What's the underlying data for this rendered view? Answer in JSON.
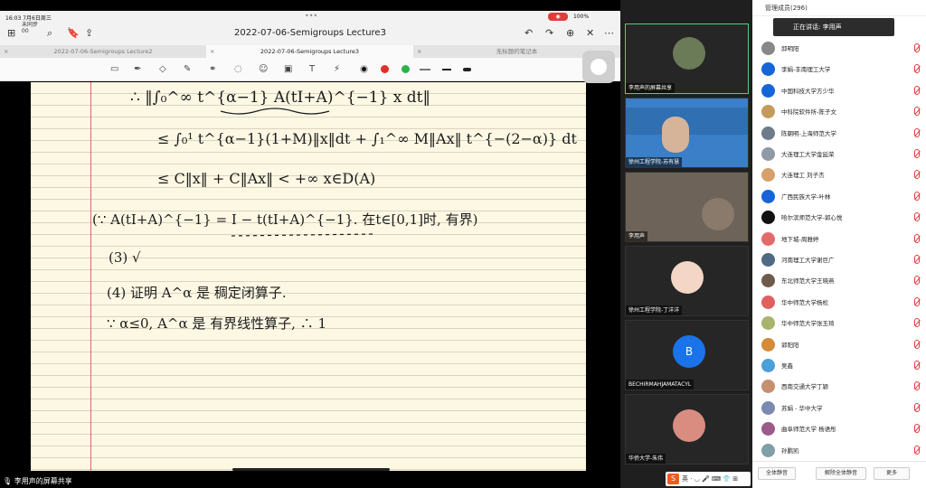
{
  "ipad": {
    "status_time": "16:03  7月6日周三",
    "battery": "100%",
    "sync_label": "未同步\n00",
    "doc_title": "2022-07-06-Semigroups Lecture3",
    "tabs": [
      "2022-07-06-Semigroups Lecture2",
      "2022-07-06-Semigroups Lecture3",
      "无标题的笔记本"
    ],
    "active_tab": 1
  },
  "share_label": "李用声的屏幕共享",
  "notes": {
    "line1": "∴ ‖∫₀^∞ t^{α−1} A(tI+A)^{−1} x dt‖",
    "line2": "≤ ∫₀¹ t^{α−1}(1+M)‖x‖dt + ∫₁^∞ M‖Ax‖ t^{−(2−α)} dt",
    "line3": "≤ C‖x‖ + C‖Ax‖ < +∞     x∈D(A)",
    "line4": "(∵ A(tI+A)^{−1} = I − t(tI+A)^{−1}. 在t∈[0,1]时, 有界)",
    "line5": "(3) √",
    "line6": "(4) 证明 A^α 是 稠定闭算子.",
    "line7": "∵ α≤0,  A^α 是 有界线性算子,  ∴ 1"
  },
  "gallery": [
    {
      "name": "李用声的屏幕共享",
      "active": true
    },
    {
      "name": "徐州工程学院-苏有慧"
    },
    {
      "name": "李用声"
    },
    {
      "name": "徐州工程学院-丁洋洋"
    },
    {
      "name": "BECHIRMAHJAMATACYL",
      "initial": "B"
    },
    {
      "name": "华侨大学-朱伟"
    }
  ],
  "ime_label": "英 · ◡ 🎤 ⌨ 👕 ⊞",
  "panel": {
    "title": "管理成员(296)",
    "tooltip": "正在讲话: 李用声",
    "participants": [
      {
        "name": "邱明阳",
        "color": "#888888"
      },
      {
        "name": "李娟-丰南理工大学",
        "color": "#1565d8"
      },
      {
        "name": "中国科技大学方少华",
        "color": "#1565d8"
      },
      {
        "name": "中科院软件所-陈子文",
        "color": "#c59a5c"
      },
      {
        "name": "陈朝明-上海师范大学",
        "color": "#6d7b8a"
      },
      {
        "name": "大连理工大学金延荣",
        "color": "#8e9aa5"
      },
      {
        "name": "大连理工 刘子杰",
        "color": "#d7a06b"
      },
      {
        "name": "广西民族大学-叶林",
        "color": "#1565d8"
      },
      {
        "name": "哈尔滨师范大学-郭心悦",
        "color": "#111111"
      },
      {
        "name": "地下城-周雅婷",
        "color": "#e36a6a"
      },
      {
        "name": "河南理工大学谢巨广",
        "color": "#4e6a84"
      },
      {
        "name": "东北师范大学王晓燕",
        "color": "#6f5a4c"
      },
      {
        "name": "华中师范大学杨松",
        "color": "#e06060"
      },
      {
        "name": "华中师范大学张玉琦",
        "color": "#a8b36b"
      },
      {
        "name": "郭阳阳",
        "color": "#d48b3a"
      },
      {
        "name": "吴鑫",
        "color": "#4aa0d8"
      },
      {
        "name": "西南交通大学丁颖",
        "color": "#c49070"
      },
      {
        "name": "苏娟 - 华中大学",
        "color": "#7a8ab0"
      },
      {
        "name": "曲阜师范大学 杨语彤",
        "color": "#9a5b8a"
      },
      {
        "name": "孙鹏凯",
        "color": "#7fa0a8"
      }
    ],
    "buttons": [
      "全体静音",
      "解除全体静音",
      "更多"
    ]
  },
  "colors": {
    "red": "#e0302a",
    "green": "#2bb34a",
    "active_border": "#4ed07a",
    "ink": "#1c1c1c"
  }
}
